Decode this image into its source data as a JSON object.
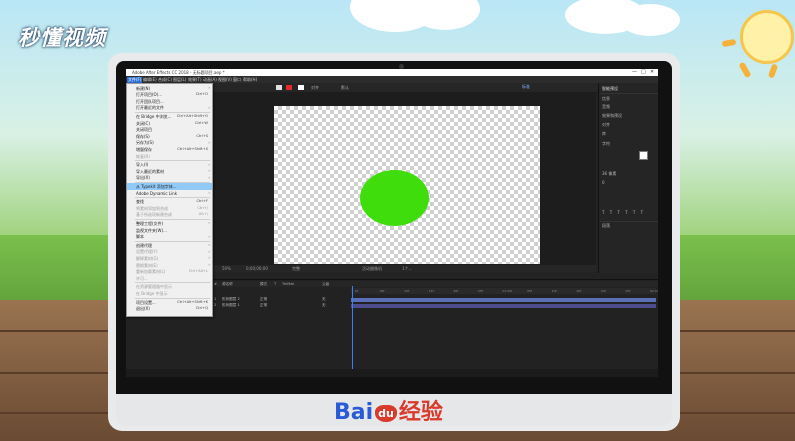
{
  "overlay": {
    "site_logo": "秒懂视频",
    "footer_logo_left": "Bai",
    "footer_logo_mid": "du",
    "footer_logo_right": "经验"
  },
  "window": {
    "title": "Adobe After Effects CC 2018 - 无标题项目.aep *",
    "controls": [
      "—",
      "□",
      "✕"
    ]
  },
  "menubar": {
    "items": [
      "文件(F)",
      "编辑(E)",
      "合成(C)",
      "图层(L)",
      "效果(T)",
      "动画(A)",
      "视图(V)",
      "窗口",
      "帮助(H)"
    ],
    "selected_index": 0
  },
  "toolbar": {
    "workspace": "默认",
    "snapping": "对齐",
    "right_label": "标准"
  },
  "file_menu": {
    "items": [
      {
        "label": "新建(N)",
        "shortcut": "",
        "arrow": true,
        "disabled": false
      },
      {
        "label": "打开项目(O)...",
        "shortcut": "Ctrl+O",
        "arrow": false,
        "disabled": false
      },
      {
        "label": "打开团队项目...",
        "shortcut": "",
        "arrow": false,
        "disabled": false
      },
      {
        "label": "打开最近的文件",
        "shortcut": "",
        "arrow": true,
        "disabled": false
      },
      {
        "label": "在 Bridge 中浏览...",
        "shortcut": "Ctrl+Alt+Shift+O",
        "arrow": false,
        "disabled": false
      },
      {
        "label": "关闭(C)",
        "shortcut": "Ctrl+W",
        "arrow": false,
        "disabled": false
      },
      {
        "label": "关闭项目",
        "shortcut": "",
        "arrow": false,
        "disabled": false
      },
      {
        "label": "保存(S)",
        "shortcut": "Ctrl+S",
        "arrow": false,
        "disabled": false
      },
      {
        "label": "另存为(S)",
        "shortcut": "",
        "arrow": true,
        "disabled": false
      },
      {
        "label": "增量保存",
        "shortcut": "Ctrl+Alt+Shift+S",
        "arrow": false,
        "disabled": false
      },
      {
        "label": "恢复(R)",
        "shortcut": "",
        "arrow": false,
        "disabled": true
      },
      {
        "label": "导入(I)",
        "shortcut": "",
        "arrow": true,
        "disabled": false
      },
      {
        "label": "导入最近的素材",
        "shortcut": "",
        "arrow": true,
        "disabled": false
      },
      {
        "label": "导出(X)",
        "shortcut": "",
        "arrow": true,
        "disabled": false
      },
      {
        "label": "从 Typekit 添加字体...",
        "shortcut": "",
        "arrow": false,
        "disabled": false,
        "highlighted": true
      },
      {
        "label": "Adobe Dynamic Link",
        "shortcut": "",
        "arrow": true,
        "disabled": false
      },
      {
        "label": "查找",
        "shortcut": "Ctrl+F",
        "arrow": false,
        "disabled": false
      },
      {
        "label": "将素材添加到合成",
        "shortcut": "Ctrl+/",
        "arrow": false,
        "disabled": true
      },
      {
        "label": "基于所选项新建合成",
        "shortcut": "Alt+\\",
        "arrow": false,
        "disabled": true
      },
      {
        "label": "整理工程(文件)",
        "shortcut": "",
        "arrow": true,
        "disabled": false
      },
      {
        "label": "监视文件夹(W)...",
        "shortcut": "",
        "arrow": false,
        "disabled": false
      },
      {
        "label": "脚本",
        "shortcut": "",
        "arrow": true,
        "disabled": false
      },
      {
        "label": "创建代理",
        "shortcut": "",
        "arrow": true,
        "disabled": false
      },
      {
        "label": "设置代理(Y)",
        "shortcut": "",
        "arrow": true,
        "disabled": true
      },
      {
        "label": "解释素材(G)",
        "shortcut": "",
        "arrow": true,
        "disabled": true
      },
      {
        "label": "替换素材(E)",
        "shortcut": "",
        "arrow": true,
        "disabled": true
      },
      {
        "label": "重新加载素材(L)",
        "shortcut": "Ctrl+Alt+L",
        "arrow": false,
        "disabled": true
      },
      {
        "label": "许可...",
        "shortcut": "",
        "arrow": false,
        "disabled": true
      },
      {
        "label": "在资源管理器中显示",
        "shortcut": "",
        "arrow": false,
        "disabled": true
      },
      {
        "label": "在 Bridge 中显示",
        "shortcut": "",
        "arrow": false,
        "disabled": true
      },
      {
        "label": "项目设置...",
        "shortcut": "Ctrl+Alt+Shift+K",
        "arrow": false,
        "disabled": false
      },
      {
        "label": "退出(X)",
        "shortcut": "Ctrl+Q",
        "arrow": false,
        "disabled": false
      }
    ]
  },
  "viewer": {
    "zoom": "50%",
    "timecode": "0;00;00;00",
    "quality": "完整",
    "camera": "活动摄像机",
    "views": "1个..."
  },
  "right_panel": {
    "tab": "智能预设",
    "rows": [
      "信息",
      "音频",
      "效果和预设",
      "对齐",
      "库",
      "字符",
      "段落"
    ],
    "font_size": "36 像素",
    "tracking": "0"
  },
  "timeline": {
    "columns": [
      "#",
      "源名称",
      "模式",
      "T",
      "TrkMat",
      "父级"
    ],
    "layers": [
      {
        "num": "1",
        "name": "形状图层 2",
        "mode": "正常",
        "parent": "无"
      },
      {
        "num": "2",
        "name": "形状图层 1",
        "mode": "正常",
        "parent": "无"
      }
    ],
    "ruler": [
      "0f",
      "05f",
      "10f",
      "15f",
      "20f",
      "25f",
      "01:00f",
      "05f",
      "10f",
      "15f",
      "20f",
      "25f",
      "02:00f"
    ]
  },
  "colors": {
    "ellipse_fill": "#3fdd0c",
    "menu_highlight": "#91c9f7",
    "menubar_selected": "#2d6fd1"
  }
}
